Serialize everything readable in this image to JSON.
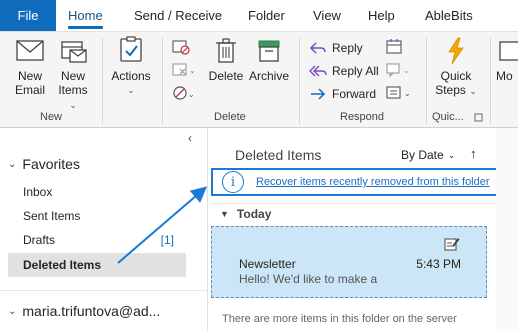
{
  "tabs": {
    "file": "File",
    "home": "Home",
    "send_receive": "Send / Receive",
    "folder": "Folder",
    "view": "View",
    "help": "Help",
    "ablebits": "AbleBits"
  },
  "ribbon": {
    "new_group": {
      "label": "New",
      "new_email_line1": "New",
      "new_email_line2": "Email",
      "new_items_line1": "New",
      "new_items_line2": "Items"
    },
    "actions": {
      "label": "Actions"
    },
    "delete_group": {
      "label": "Delete",
      "delete": "Delete",
      "archive": "Archive"
    },
    "respond_group": {
      "label": "Respond",
      "reply": "Reply",
      "reply_all": "Reply All",
      "forward": "Forward"
    },
    "quick_group": {
      "label": "Quic...",
      "quick_steps_line1": "Quick",
      "quick_steps_line2": "Steps"
    },
    "more_label": "Mo"
  },
  "nav": {
    "favorites": "Favorites",
    "items": [
      {
        "label": "Inbox",
        "count": ""
      },
      {
        "label": "Sent Items",
        "count": ""
      },
      {
        "label": "Drafts",
        "count": "[1]"
      },
      {
        "label": "Deleted Items",
        "count": ""
      }
    ],
    "account": "maria.trifuntova@ad..."
  },
  "list": {
    "title": "Deleted Items",
    "sort_label": "By Date",
    "recover_link": "Recover items recently removed from this folder",
    "group_today": "Today",
    "message": {
      "from": "Newsletter",
      "time": "5:43 PM",
      "preview": "Hello!  We'd like to make a"
    },
    "more_items": "There are more items in this folder on the server"
  },
  "colors": {
    "accent": "#0f6cbd",
    "callout": "#1a7ad8",
    "selected_message": "#cce6f7",
    "quick_steps_bolt": "#f2a900",
    "archive_green": "#2e8b57"
  }
}
